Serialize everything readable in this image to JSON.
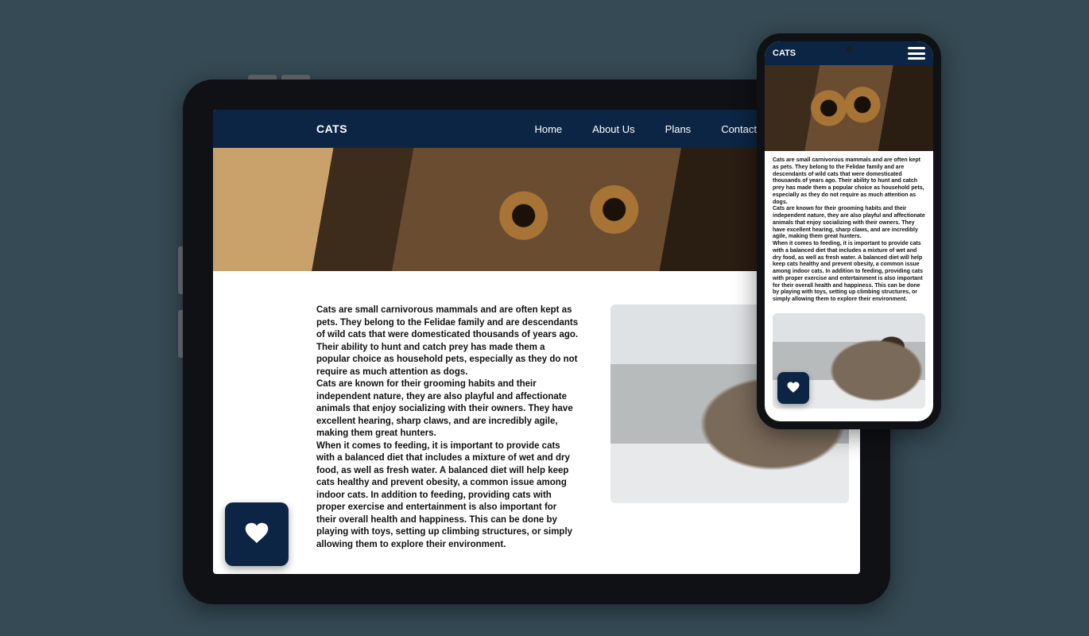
{
  "site": {
    "logo": "CATS",
    "nav": [
      "Home",
      "About Us",
      "Plans",
      "Contact"
    ]
  },
  "content": {
    "p1": "Cats are small carnivorous mammals and are often kept as pets. They belong to the Felidae family and are descendants of wild cats that were domesticated thousands of years ago. Their ability to hunt and catch prey has made them a popular choice as household pets, especially as they do not require as much attention as dogs.",
    "p2": "Cats are known for their grooming habits and their independent nature, they are also playful and affectionate animals that enjoy socializing with their owners. They have excellent hearing, sharp claws, and are incredibly agile, making them great hunters.",
    "p3": "When it comes to feeding, it is important to provide cats with a balanced diet that includes a mixture of wet and dry food, as well as fresh water. A balanced diet will help keep cats healthy and prevent obesity, a common issue among indoor cats. In addition to feeding, providing cats with proper exercise and entertainment is also important for their overall health and happiness. This can be done by playing with toys, setting up climbing structures, or simply allowing them to explore their environment."
  },
  "icons": {
    "fab": "heart-dropdown-icon",
    "menu": "hamburger-menu-icon"
  },
  "colors": {
    "header_bg": "#0c2544",
    "page_bg": "#354a54",
    "device_bg": "#0f1115"
  }
}
